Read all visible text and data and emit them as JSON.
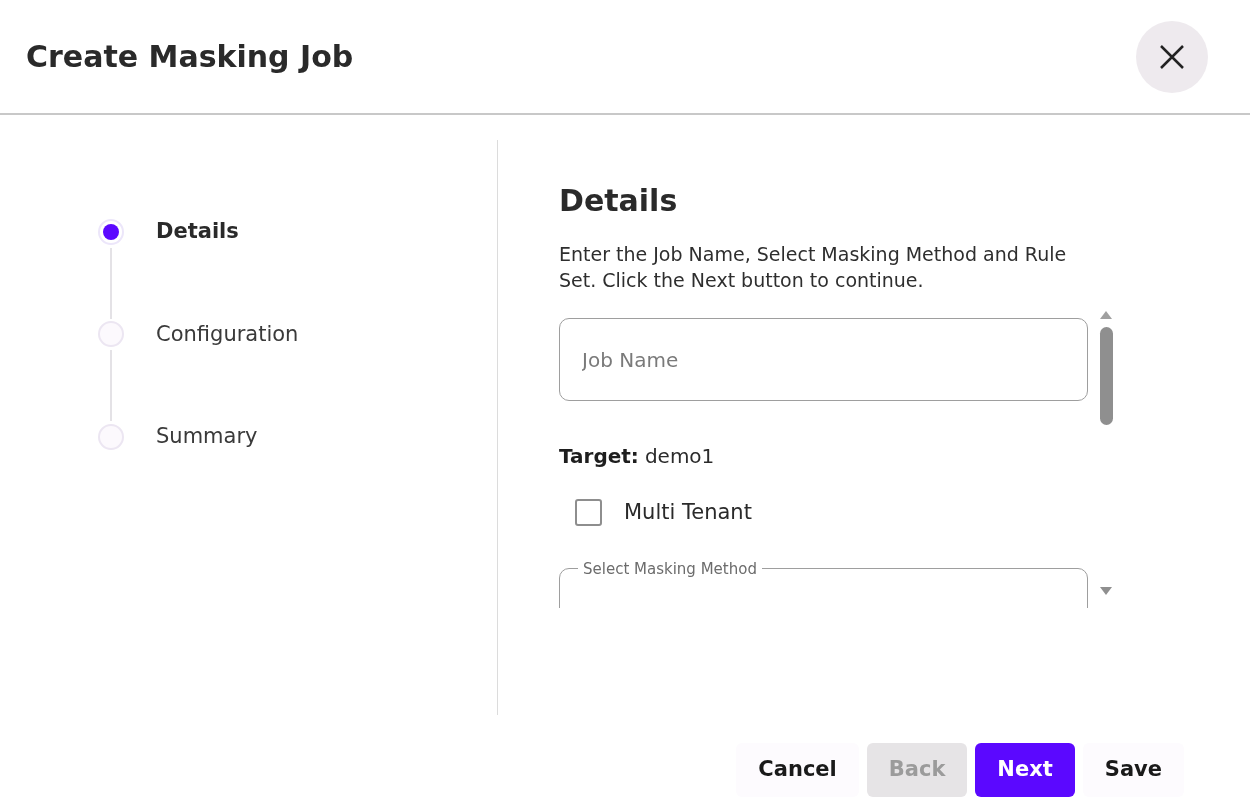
{
  "dialog": {
    "title": "Create Masking Job"
  },
  "steps": [
    {
      "label": "Details",
      "selected": true
    },
    {
      "label": "Configuration",
      "selected": false
    },
    {
      "label": "Summary",
      "selected": false
    }
  ],
  "section": {
    "title": "Details",
    "description": "Enter the Job Name, Select Masking Method and Rule Set. Click the Next button to continue."
  },
  "form": {
    "job_name": {
      "placeholder": "Job Name"
    },
    "target_label": "Target:",
    "target_value": "demo1",
    "multi_tenant": {
      "label": "Multi Tenant",
      "checked": false
    },
    "masking_method": {
      "label": "Select Masking Method"
    }
  },
  "buttons": [
    {
      "label": "Cancel",
      "kind": "text",
      "disabled": false
    },
    {
      "label": "Back",
      "kind": "secondary",
      "disabled": true
    },
    {
      "label": "Next",
      "kind": "primary",
      "disabled": false
    },
    {
      "label": "Save",
      "kind": "text",
      "disabled": false
    }
  ]
}
